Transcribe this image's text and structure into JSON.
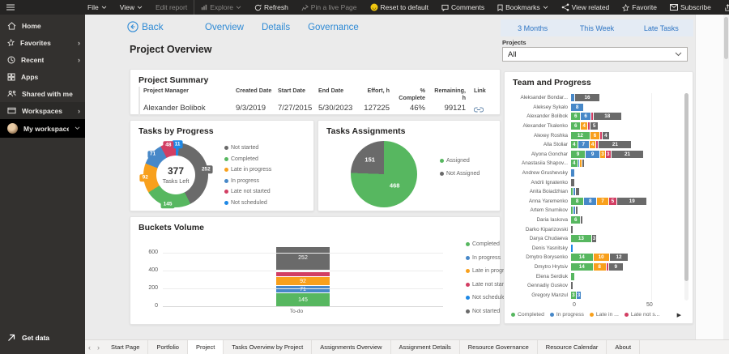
{
  "theme": {
    "accent": "#2E8AD5",
    "topbar_bg": "#252423",
    "sidebar_bg": "#33312F",
    "canvas_bg": "#EBEBEB",
    "quick_button_bg": "#E4EBF4",
    "quick_button_text": "#2E75C4",
    "status_colors": {
      "completed": "#57B760",
      "in_progress": "#4788C8",
      "late_in_progress": "#F8A01C",
      "late_not_started": "#D23E63",
      "not_scheduled": "#1E88E5",
      "not_started": "#6A6A6A"
    }
  },
  "topbar": {
    "left": [
      {
        "label": "File",
        "chevron": true,
        "disabled": false
      },
      {
        "label": "View",
        "chevron": true,
        "disabled": false
      },
      {
        "label": "Edit report",
        "chevron": false,
        "disabled": true
      },
      {
        "label": "Explore",
        "icon": "explore",
        "chevron": true,
        "disabled": true,
        "divider": true
      },
      {
        "label": "Refresh",
        "icon": "refresh",
        "chevron": false,
        "disabled": false
      }
    ],
    "right": [
      {
        "label": "Pin a live Page",
        "icon": "pin",
        "disabled": true
      },
      {
        "label": "Reset to default",
        "icon": "reset",
        "disabled": false
      },
      {
        "label": "Comments",
        "icon": "comment",
        "disabled": false
      },
      {
        "label": "Bookmarks",
        "icon": "bookmark",
        "chevron": true,
        "disabled": false
      },
      {
        "label": "View related",
        "icon": "view-related",
        "disabled": false
      },
      {
        "label": "Favorite",
        "icon": "star",
        "disabled": false
      },
      {
        "label": "Subscribe",
        "icon": "envelope",
        "disabled": false
      },
      {
        "label": "Share",
        "icon": "share",
        "disabled": false
      }
    ]
  },
  "sidebar": {
    "items": [
      {
        "label": "Home",
        "icon": "home"
      },
      {
        "label": "Favorites",
        "icon": "star",
        "expand": true
      },
      {
        "label": "Recent",
        "icon": "clock",
        "expand": true
      },
      {
        "label": "Apps",
        "icon": "apps"
      },
      {
        "label": "Shared with me",
        "icon": "shared"
      },
      {
        "label": "Workspaces",
        "icon": "workspaces",
        "expand": true,
        "highlight": true
      },
      {
        "label": "My workspace",
        "icon": "avatar",
        "chevron_down": true,
        "active": true
      }
    ],
    "get_data": "Get data"
  },
  "header": {
    "back_label": "Back",
    "tabs": [
      "Overview",
      "Details",
      "Governance"
    ],
    "quick_buttons": [
      "3 Months",
      "This Week",
      "Late Tasks"
    ],
    "projects_label": "Projects",
    "projects_value": "All",
    "page_title": "Project Overview"
  },
  "summary": {
    "title": "Project Summary",
    "columns": [
      "Project Manager",
      "Created Date",
      "Start Date",
      "End Date",
      "Effort, h",
      "% Complete",
      "Remaining, h",
      "Link"
    ],
    "values": [
      "Alexander Bolibok",
      "9/3/2019",
      "7/27/2015",
      "5/30/2023",
      "127225",
      "46%",
      "99121"
    ]
  },
  "chart_data": [
    {
      "id": "tasks_by_progress",
      "type": "pie",
      "donut": true,
      "title": "Tasks by Progress",
      "center_value": "377",
      "center_label": "Tasks Left",
      "slices": [
        {
          "label": "Not scheduled",
          "value": 11,
          "color": "#1E88E5"
        },
        {
          "label": "Not started",
          "value": 252,
          "color": "#6A6A6A"
        },
        {
          "label": "Completed",
          "value": 145,
          "color": "#57B760"
        },
        {
          "label": "Late in progress",
          "value": 92,
          "color": "#F8A01C"
        },
        {
          "label": "In progress",
          "value": 71,
          "color": "#4788C8"
        },
        {
          "label": "Late not started",
          "value": 48,
          "color": "#D23E63"
        }
      ],
      "legend": [
        "Not started",
        "Completed",
        "Late in progress",
        "In progress",
        "Late not started",
        "Not scheduled"
      ],
      "legend_position": "right"
    },
    {
      "id": "tasks_assignments",
      "type": "pie",
      "donut": false,
      "title": "Tasks Assignments",
      "slices": [
        {
          "label": "Assigned",
          "value": 468,
          "color": "#57B760"
        },
        {
          "label": "Not Assigned",
          "value": 151,
          "color": "#6A6A6A"
        }
      ],
      "legend": [
        "Assigned",
        "Not Assigned"
      ],
      "legend_position": "right"
    },
    {
      "id": "buckets_volume",
      "type": "bar",
      "stacked": true,
      "title": "Buckets Volume",
      "categories": [
        "To-do"
      ],
      "xlabel": "To-do",
      "ylabel": "",
      "series": [
        {
          "name": "Completed",
          "color": "#57B760",
          "values": [
            145
          ]
        },
        {
          "name": "In progress",
          "color": "#4788C8",
          "values": [
            71
          ]
        },
        {
          "name": "Late in progress",
          "color": "#F8A01C",
          "values": [
            92
          ]
        },
        {
          "name": "Late not started",
          "color": "#D23E63",
          "values": [
            48
          ]
        },
        {
          "name": "Not scheduled",
          "color": "#1E88E5",
          "values": [
            11
          ]
        },
        {
          "name": "Not started",
          "color": "#6A6A6A",
          "values": [
            252
          ]
        }
      ],
      "ylim": [
        0,
        600
      ],
      "yticks": [
        0,
        200,
        400,
        600
      ],
      "label_min_value": 60,
      "legend": [
        "Completed",
        "In progress",
        "Late in progress",
        "Late not started",
        "Not scheduled",
        "Not started"
      ],
      "legend_position": "right"
    },
    {
      "id": "team_and_progress",
      "type": "bar",
      "orientation": "horizontal",
      "stacked": true,
      "title": "Team and Progress",
      "categories": [
        "Aleksander Bondar...",
        "Aleksey Sykalo",
        "Alexander Bolibok",
        "Alexander Tkalenko",
        "Alexey Roshka",
        "Alla Stoliar",
        "Alyona Gonchar",
        "Anastasiia Shapov...",
        "Andrew Grushevsky",
        "Andrii Ignatenko",
        "Anita Boiadzhian",
        "Anna Yaremenko",
        "Artem Snurnikov",
        "Daria Iaskova",
        "Darko Kiparizovski",
        "Darya Chudaeva",
        "Denis Yasnitsky",
        "Dmytro Borysenko",
        "Dmytro Hrytsiv",
        "Elena Serdiuk",
        "Gennadiy Guskov",
        "Gregory Manzul"
      ],
      "series": [
        {
          "name": "Completed",
          "color": "#57B760",
          "values": [
            0,
            0,
            6,
            6,
            12,
            4,
            9,
            4,
            0,
            0,
            1,
            8,
            1,
            6,
            0,
            13,
            0,
            14,
            14,
            2,
            0,
            3
          ]
        },
        {
          "name": "In progress",
          "color": "#4788C8",
          "values": [
            2,
            8,
            6,
            0,
            0,
            7,
            9,
            1,
            2,
            0,
            1,
            8,
            1,
            0,
            0,
            0,
            0,
            0,
            0,
            0,
            0,
            3
          ]
        },
        {
          "name": "Late in progress",
          "color": "#F8A01C",
          "values": [
            0,
            0,
            0,
            4,
            6,
            4,
            3,
            1,
            0,
            0,
            0,
            7,
            0,
            0,
            0,
            0,
            0,
            10,
            8,
            0,
            0,
            0
          ]
        },
        {
          "name": "Late not started",
          "color": "#D23E63",
          "values": [
            0,
            0,
            1,
            1,
            1,
            1,
            3,
            0,
            0,
            0,
            0,
            5,
            0,
            0,
            0,
            0,
            0,
            0,
            1,
            0,
            0,
            0
          ]
        },
        {
          "name": "Not scheduled",
          "color": "#1E88E5",
          "values": [
            0,
            0,
            0,
            0,
            0,
            0,
            0,
            0,
            0,
            0,
            0,
            0,
            0,
            0,
            0,
            0,
            1,
            0,
            0,
            0,
            0,
            0
          ]
        },
        {
          "name": "Not started",
          "color": "#6A6A6A",
          "values": [
            16,
            0,
            18,
            5,
            4,
            21,
            21,
            1,
            0,
            2,
            2,
            19,
            1,
            1,
            1,
            3,
            0,
            12,
            9,
            0,
            1,
            0
          ]
        }
      ],
      "xlim": [
        0,
        50
      ],
      "xticks": [
        0,
        50
      ],
      "label_min_value": 3,
      "legend": [
        "Completed",
        "In progress",
        "Late in ...",
        "Late not s..."
      ],
      "legend_position": "bottom"
    }
  ],
  "bottom_tabs": {
    "prev_icon": "‹",
    "next_icon": "›",
    "tabs": [
      "Start Page",
      "Portfolio",
      "Project",
      "Tasks Overview by Project",
      "Assignments Overview",
      "Assignment Details",
      "Resource Governance",
      "Resource Calendar",
      "About"
    ],
    "active": "Project"
  }
}
